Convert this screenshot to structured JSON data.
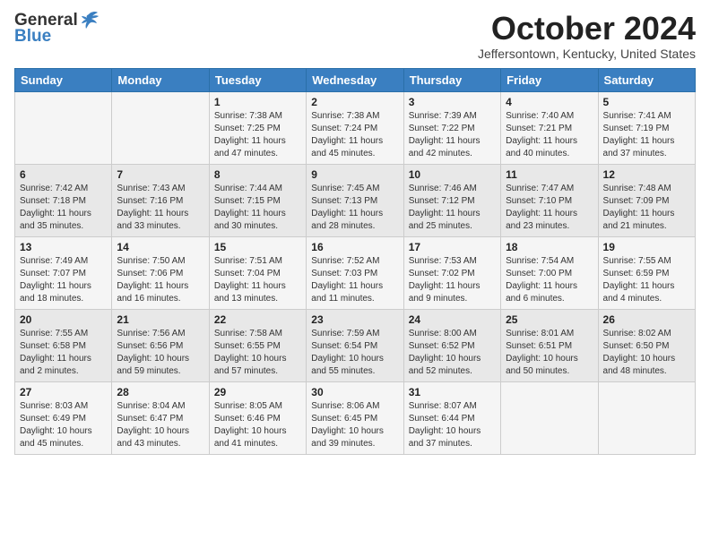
{
  "header": {
    "logo_general": "General",
    "logo_blue": "Blue",
    "month_title": "October 2024",
    "location": "Jeffersontown, Kentucky, United States"
  },
  "weekdays": [
    "Sunday",
    "Monday",
    "Tuesday",
    "Wednesday",
    "Thursday",
    "Friday",
    "Saturday"
  ],
  "weeks": [
    [
      {
        "day": "",
        "sunrise": "",
        "sunset": "",
        "daylight": ""
      },
      {
        "day": "",
        "sunrise": "",
        "sunset": "",
        "daylight": ""
      },
      {
        "day": "1",
        "sunrise": "Sunrise: 7:38 AM",
        "sunset": "Sunset: 7:25 PM",
        "daylight": "Daylight: 11 hours and 47 minutes."
      },
      {
        "day": "2",
        "sunrise": "Sunrise: 7:38 AM",
        "sunset": "Sunset: 7:24 PM",
        "daylight": "Daylight: 11 hours and 45 minutes."
      },
      {
        "day": "3",
        "sunrise": "Sunrise: 7:39 AM",
        "sunset": "Sunset: 7:22 PM",
        "daylight": "Daylight: 11 hours and 42 minutes."
      },
      {
        "day": "4",
        "sunrise": "Sunrise: 7:40 AM",
        "sunset": "Sunset: 7:21 PM",
        "daylight": "Daylight: 11 hours and 40 minutes."
      },
      {
        "day": "5",
        "sunrise": "Sunrise: 7:41 AM",
        "sunset": "Sunset: 7:19 PM",
        "daylight": "Daylight: 11 hours and 37 minutes."
      }
    ],
    [
      {
        "day": "6",
        "sunrise": "Sunrise: 7:42 AM",
        "sunset": "Sunset: 7:18 PM",
        "daylight": "Daylight: 11 hours and 35 minutes."
      },
      {
        "day": "7",
        "sunrise": "Sunrise: 7:43 AM",
        "sunset": "Sunset: 7:16 PM",
        "daylight": "Daylight: 11 hours and 33 minutes."
      },
      {
        "day": "8",
        "sunrise": "Sunrise: 7:44 AM",
        "sunset": "Sunset: 7:15 PM",
        "daylight": "Daylight: 11 hours and 30 minutes."
      },
      {
        "day": "9",
        "sunrise": "Sunrise: 7:45 AM",
        "sunset": "Sunset: 7:13 PM",
        "daylight": "Daylight: 11 hours and 28 minutes."
      },
      {
        "day": "10",
        "sunrise": "Sunrise: 7:46 AM",
        "sunset": "Sunset: 7:12 PM",
        "daylight": "Daylight: 11 hours and 25 minutes."
      },
      {
        "day": "11",
        "sunrise": "Sunrise: 7:47 AM",
        "sunset": "Sunset: 7:10 PM",
        "daylight": "Daylight: 11 hours and 23 minutes."
      },
      {
        "day": "12",
        "sunrise": "Sunrise: 7:48 AM",
        "sunset": "Sunset: 7:09 PM",
        "daylight": "Daylight: 11 hours and 21 minutes."
      }
    ],
    [
      {
        "day": "13",
        "sunrise": "Sunrise: 7:49 AM",
        "sunset": "Sunset: 7:07 PM",
        "daylight": "Daylight: 11 hours and 18 minutes."
      },
      {
        "day": "14",
        "sunrise": "Sunrise: 7:50 AM",
        "sunset": "Sunset: 7:06 PM",
        "daylight": "Daylight: 11 hours and 16 minutes."
      },
      {
        "day": "15",
        "sunrise": "Sunrise: 7:51 AM",
        "sunset": "Sunset: 7:04 PM",
        "daylight": "Daylight: 11 hours and 13 minutes."
      },
      {
        "day": "16",
        "sunrise": "Sunrise: 7:52 AM",
        "sunset": "Sunset: 7:03 PM",
        "daylight": "Daylight: 11 hours and 11 minutes."
      },
      {
        "day": "17",
        "sunrise": "Sunrise: 7:53 AM",
        "sunset": "Sunset: 7:02 PM",
        "daylight": "Daylight: 11 hours and 9 minutes."
      },
      {
        "day": "18",
        "sunrise": "Sunrise: 7:54 AM",
        "sunset": "Sunset: 7:00 PM",
        "daylight": "Daylight: 11 hours and 6 minutes."
      },
      {
        "day": "19",
        "sunrise": "Sunrise: 7:55 AM",
        "sunset": "Sunset: 6:59 PM",
        "daylight": "Daylight: 11 hours and 4 minutes."
      }
    ],
    [
      {
        "day": "20",
        "sunrise": "Sunrise: 7:55 AM",
        "sunset": "Sunset: 6:58 PM",
        "daylight": "Daylight: 11 hours and 2 minutes."
      },
      {
        "day": "21",
        "sunrise": "Sunrise: 7:56 AM",
        "sunset": "Sunset: 6:56 PM",
        "daylight": "Daylight: 10 hours and 59 minutes."
      },
      {
        "day": "22",
        "sunrise": "Sunrise: 7:58 AM",
        "sunset": "Sunset: 6:55 PM",
        "daylight": "Daylight: 10 hours and 57 minutes."
      },
      {
        "day": "23",
        "sunrise": "Sunrise: 7:59 AM",
        "sunset": "Sunset: 6:54 PM",
        "daylight": "Daylight: 10 hours and 55 minutes."
      },
      {
        "day": "24",
        "sunrise": "Sunrise: 8:00 AM",
        "sunset": "Sunset: 6:52 PM",
        "daylight": "Daylight: 10 hours and 52 minutes."
      },
      {
        "day": "25",
        "sunrise": "Sunrise: 8:01 AM",
        "sunset": "Sunset: 6:51 PM",
        "daylight": "Daylight: 10 hours and 50 minutes."
      },
      {
        "day": "26",
        "sunrise": "Sunrise: 8:02 AM",
        "sunset": "Sunset: 6:50 PM",
        "daylight": "Daylight: 10 hours and 48 minutes."
      }
    ],
    [
      {
        "day": "27",
        "sunrise": "Sunrise: 8:03 AM",
        "sunset": "Sunset: 6:49 PM",
        "daylight": "Daylight: 10 hours and 45 minutes."
      },
      {
        "day": "28",
        "sunrise": "Sunrise: 8:04 AM",
        "sunset": "Sunset: 6:47 PM",
        "daylight": "Daylight: 10 hours and 43 minutes."
      },
      {
        "day": "29",
        "sunrise": "Sunrise: 8:05 AM",
        "sunset": "Sunset: 6:46 PM",
        "daylight": "Daylight: 10 hours and 41 minutes."
      },
      {
        "day": "30",
        "sunrise": "Sunrise: 8:06 AM",
        "sunset": "Sunset: 6:45 PM",
        "daylight": "Daylight: 10 hours and 39 minutes."
      },
      {
        "day": "31",
        "sunrise": "Sunrise: 8:07 AM",
        "sunset": "Sunset: 6:44 PM",
        "daylight": "Daylight: 10 hours and 37 minutes."
      },
      {
        "day": "",
        "sunrise": "",
        "sunset": "",
        "daylight": ""
      },
      {
        "day": "",
        "sunrise": "",
        "sunset": "",
        "daylight": ""
      }
    ]
  ]
}
